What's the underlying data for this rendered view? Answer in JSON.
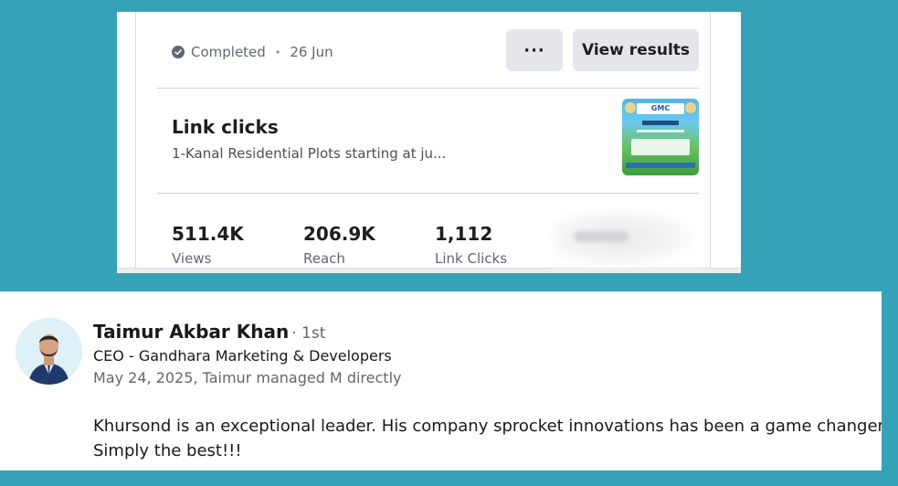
{
  "ad_result": {
    "status": "Completed",
    "date": "26 Jun",
    "more_label": "···",
    "view_results_label": "View results",
    "objective": "Link clicks",
    "ad_text": "1-Kanal Residential Plots starting at ju...",
    "thumbnail_brand": "GMC",
    "metrics": [
      {
        "value": "511.4K",
        "label": "Views"
      },
      {
        "value": "206.9K",
        "label": "Reach"
      },
      {
        "value": "1,112",
        "label": "Link Clicks"
      }
    ],
    "status_icon": "check-circle-icon"
  },
  "recommendation": {
    "name": "Taimur Akbar Khan",
    "degree": "· 1st",
    "headline": "CEO - Gandhara Marketing & Developers",
    "meta": "May 24, 2025, Taimur managed M directly",
    "text_line1": "Khursond is an exceptional leader. His company sprocket innovations has been a game changer.",
    "text_line2": "Simply the best!!!"
  },
  "colors": {
    "background": "#35a2b8",
    "button_bg": "#e4e6eb",
    "text_primary": "#1c1e21",
    "text_secondary": "#606770"
  }
}
